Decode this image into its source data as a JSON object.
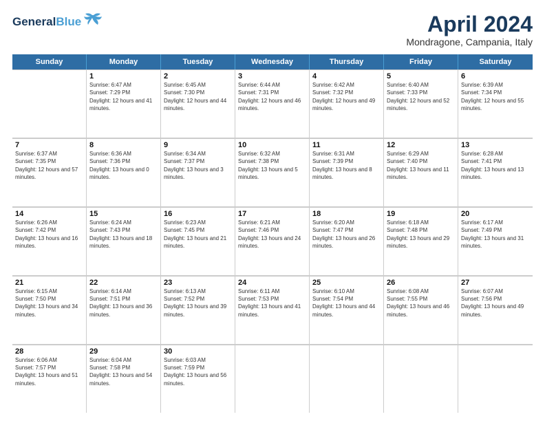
{
  "header": {
    "logo_line1": "General",
    "logo_line2": "Blue",
    "month_title": "April 2024",
    "location": "Mondragone, Campania, Italy"
  },
  "calendar": {
    "days": [
      "Sunday",
      "Monday",
      "Tuesday",
      "Wednesday",
      "Thursday",
      "Friday",
      "Saturday"
    ],
    "weeks": [
      [
        {
          "date": "",
          "sunrise": "",
          "sunset": "",
          "daylight": ""
        },
        {
          "date": "1",
          "sunrise": "Sunrise: 6:47 AM",
          "sunset": "Sunset: 7:29 PM",
          "daylight": "Daylight: 12 hours and 41 minutes."
        },
        {
          "date": "2",
          "sunrise": "Sunrise: 6:45 AM",
          "sunset": "Sunset: 7:30 PM",
          "daylight": "Daylight: 12 hours and 44 minutes."
        },
        {
          "date": "3",
          "sunrise": "Sunrise: 6:44 AM",
          "sunset": "Sunset: 7:31 PM",
          "daylight": "Daylight: 12 hours and 46 minutes."
        },
        {
          "date": "4",
          "sunrise": "Sunrise: 6:42 AM",
          "sunset": "Sunset: 7:32 PM",
          "daylight": "Daylight: 12 hours and 49 minutes."
        },
        {
          "date": "5",
          "sunrise": "Sunrise: 6:40 AM",
          "sunset": "Sunset: 7:33 PM",
          "daylight": "Daylight: 12 hours and 52 minutes."
        },
        {
          "date": "6",
          "sunrise": "Sunrise: 6:39 AM",
          "sunset": "Sunset: 7:34 PM",
          "daylight": "Daylight: 12 hours and 55 minutes."
        }
      ],
      [
        {
          "date": "7",
          "sunrise": "Sunrise: 6:37 AM",
          "sunset": "Sunset: 7:35 PM",
          "daylight": "Daylight: 12 hours and 57 minutes."
        },
        {
          "date": "8",
          "sunrise": "Sunrise: 6:36 AM",
          "sunset": "Sunset: 7:36 PM",
          "daylight": "Daylight: 13 hours and 0 minutes."
        },
        {
          "date": "9",
          "sunrise": "Sunrise: 6:34 AM",
          "sunset": "Sunset: 7:37 PM",
          "daylight": "Daylight: 13 hours and 3 minutes."
        },
        {
          "date": "10",
          "sunrise": "Sunrise: 6:32 AM",
          "sunset": "Sunset: 7:38 PM",
          "daylight": "Daylight: 13 hours and 5 minutes."
        },
        {
          "date": "11",
          "sunrise": "Sunrise: 6:31 AM",
          "sunset": "Sunset: 7:39 PM",
          "daylight": "Daylight: 13 hours and 8 minutes."
        },
        {
          "date": "12",
          "sunrise": "Sunrise: 6:29 AM",
          "sunset": "Sunset: 7:40 PM",
          "daylight": "Daylight: 13 hours and 11 minutes."
        },
        {
          "date": "13",
          "sunrise": "Sunrise: 6:28 AM",
          "sunset": "Sunset: 7:41 PM",
          "daylight": "Daylight: 13 hours and 13 minutes."
        }
      ],
      [
        {
          "date": "14",
          "sunrise": "Sunrise: 6:26 AM",
          "sunset": "Sunset: 7:42 PM",
          "daylight": "Daylight: 13 hours and 16 minutes."
        },
        {
          "date": "15",
          "sunrise": "Sunrise: 6:24 AM",
          "sunset": "Sunset: 7:43 PM",
          "daylight": "Daylight: 13 hours and 18 minutes."
        },
        {
          "date": "16",
          "sunrise": "Sunrise: 6:23 AM",
          "sunset": "Sunset: 7:45 PM",
          "daylight": "Daylight: 13 hours and 21 minutes."
        },
        {
          "date": "17",
          "sunrise": "Sunrise: 6:21 AM",
          "sunset": "Sunset: 7:46 PM",
          "daylight": "Daylight: 13 hours and 24 minutes."
        },
        {
          "date": "18",
          "sunrise": "Sunrise: 6:20 AM",
          "sunset": "Sunset: 7:47 PM",
          "daylight": "Daylight: 13 hours and 26 minutes."
        },
        {
          "date": "19",
          "sunrise": "Sunrise: 6:18 AM",
          "sunset": "Sunset: 7:48 PM",
          "daylight": "Daylight: 13 hours and 29 minutes."
        },
        {
          "date": "20",
          "sunrise": "Sunrise: 6:17 AM",
          "sunset": "Sunset: 7:49 PM",
          "daylight": "Daylight: 13 hours and 31 minutes."
        }
      ],
      [
        {
          "date": "21",
          "sunrise": "Sunrise: 6:15 AM",
          "sunset": "Sunset: 7:50 PM",
          "daylight": "Daylight: 13 hours and 34 minutes."
        },
        {
          "date": "22",
          "sunrise": "Sunrise: 6:14 AM",
          "sunset": "Sunset: 7:51 PM",
          "daylight": "Daylight: 13 hours and 36 minutes."
        },
        {
          "date": "23",
          "sunrise": "Sunrise: 6:13 AM",
          "sunset": "Sunset: 7:52 PM",
          "daylight": "Daylight: 13 hours and 39 minutes."
        },
        {
          "date": "24",
          "sunrise": "Sunrise: 6:11 AM",
          "sunset": "Sunset: 7:53 PM",
          "daylight": "Daylight: 13 hours and 41 minutes."
        },
        {
          "date": "25",
          "sunrise": "Sunrise: 6:10 AM",
          "sunset": "Sunset: 7:54 PM",
          "daylight": "Daylight: 13 hours and 44 minutes."
        },
        {
          "date": "26",
          "sunrise": "Sunrise: 6:08 AM",
          "sunset": "Sunset: 7:55 PM",
          "daylight": "Daylight: 13 hours and 46 minutes."
        },
        {
          "date": "27",
          "sunrise": "Sunrise: 6:07 AM",
          "sunset": "Sunset: 7:56 PM",
          "daylight": "Daylight: 13 hours and 49 minutes."
        }
      ],
      [
        {
          "date": "28",
          "sunrise": "Sunrise: 6:06 AM",
          "sunset": "Sunset: 7:57 PM",
          "daylight": "Daylight: 13 hours and 51 minutes."
        },
        {
          "date": "29",
          "sunrise": "Sunrise: 6:04 AM",
          "sunset": "Sunset: 7:58 PM",
          "daylight": "Daylight: 13 hours and 54 minutes."
        },
        {
          "date": "30",
          "sunrise": "Sunrise: 6:03 AM",
          "sunset": "Sunset: 7:59 PM",
          "daylight": "Daylight: 13 hours and 56 minutes."
        },
        {
          "date": "",
          "sunrise": "",
          "sunset": "",
          "daylight": ""
        },
        {
          "date": "",
          "sunrise": "",
          "sunset": "",
          "daylight": ""
        },
        {
          "date": "",
          "sunrise": "",
          "sunset": "",
          "daylight": ""
        },
        {
          "date": "",
          "sunrise": "",
          "sunset": "",
          "daylight": ""
        }
      ]
    ]
  }
}
